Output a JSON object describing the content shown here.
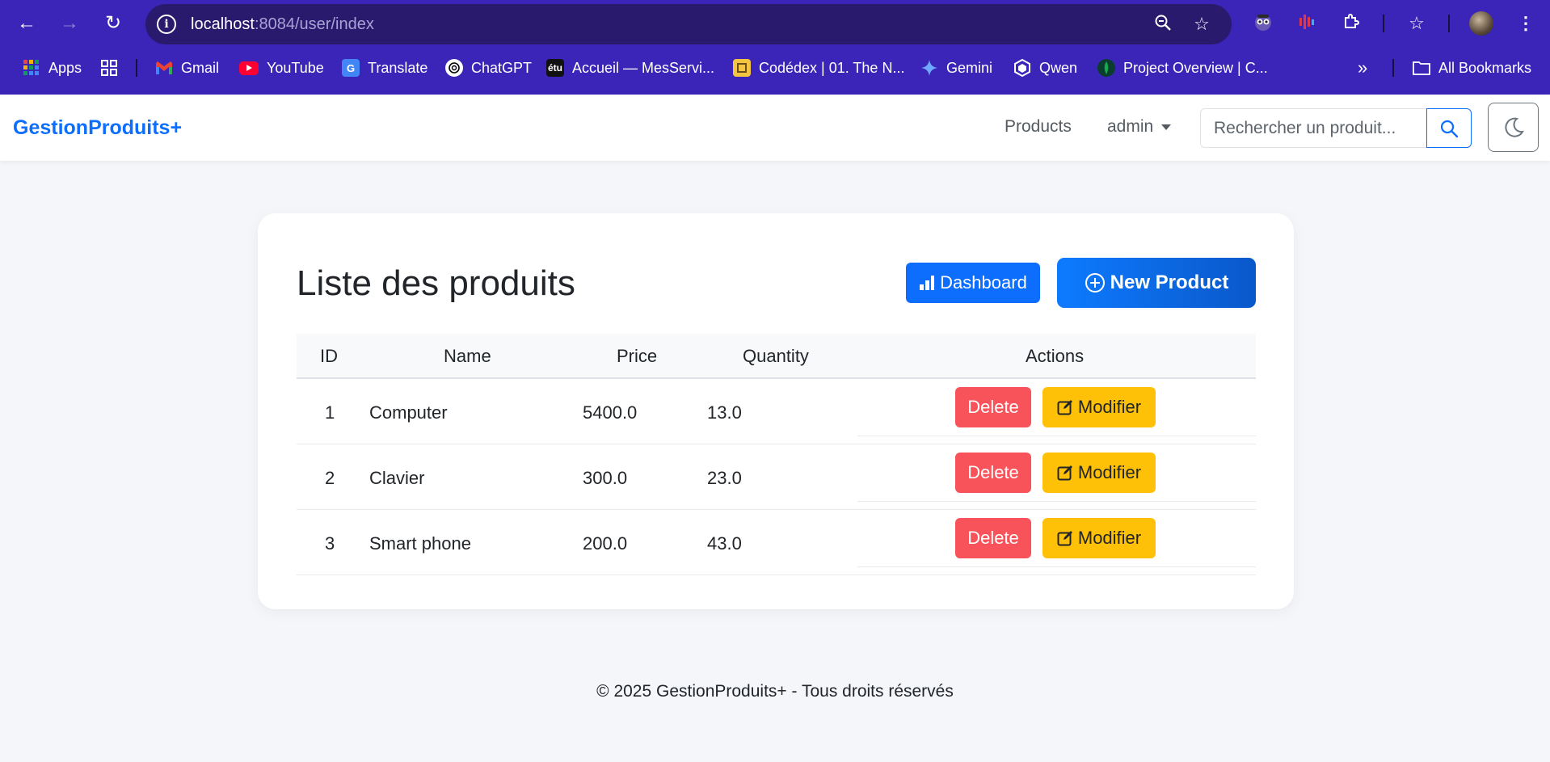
{
  "browser": {
    "url_host": "localhost",
    "url_rest": ":8084/user/index",
    "bookmarks": [
      {
        "label": "Apps",
        "icon": "apps-grid-icon"
      },
      {
        "label": "Gmail",
        "icon": "gmail-icon"
      },
      {
        "label": "YouTube",
        "icon": "youtube-icon"
      },
      {
        "label": "Translate",
        "icon": "translate-icon"
      },
      {
        "label": "ChatGPT",
        "icon": "chatgpt-icon"
      },
      {
        "label": "Accueil — MesServi...",
        "icon": "etu-icon",
        "icon_text": "étu"
      },
      {
        "label": "Codédex | 01. The N...",
        "icon": "codedex-icon"
      },
      {
        "label": "Gemini",
        "icon": "gemini-icon"
      },
      {
        "label": "Qwen",
        "icon": "qwen-icon"
      },
      {
        "label": "Project Overview | C...",
        "icon": "mongodb-icon"
      }
    ],
    "all_bookmarks": "All Bookmarks",
    "overflow": "»"
  },
  "navbar": {
    "brand": "GestionProduits+",
    "products_link": "Products",
    "user_menu": "admin",
    "search_placeholder": "Rechercher un produit..."
  },
  "main": {
    "title": "Liste des produits",
    "dashboard_button": "Dashboard",
    "new_product_button": "New Product",
    "table": {
      "headers": {
        "id": "ID",
        "name": "Name",
        "price": "Price",
        "quantity": "Quantity",
        "actions": "Actions"
      },
      "rows": [
        {
          "id": "1",
          "name": "Computer",
          "price": "5400.0",
          "quantity": "13.0"
        },
        {
          "id": "2",
          "name": "Clavier",
          "price": "300.0",
          "quantity": "23.0"
        },
        {
          "id": "3",
          "name": "Smart phone",
          "price": "200.0",
          "quantity": "43.0"
        }
      ],
      "delete_label": "Delete",
      "edit_label": "Modifier"
    }
  },
  "footer": {
    "text": "© 2025 GestionProduits+ - Tous droits réservés"
  },
  "colors": {
    "primary": "#0d6efd",
    "danger": "#f8535a",
    "warning": "#ffc107",
    "chrome": "#3a25b8"
  }
}
